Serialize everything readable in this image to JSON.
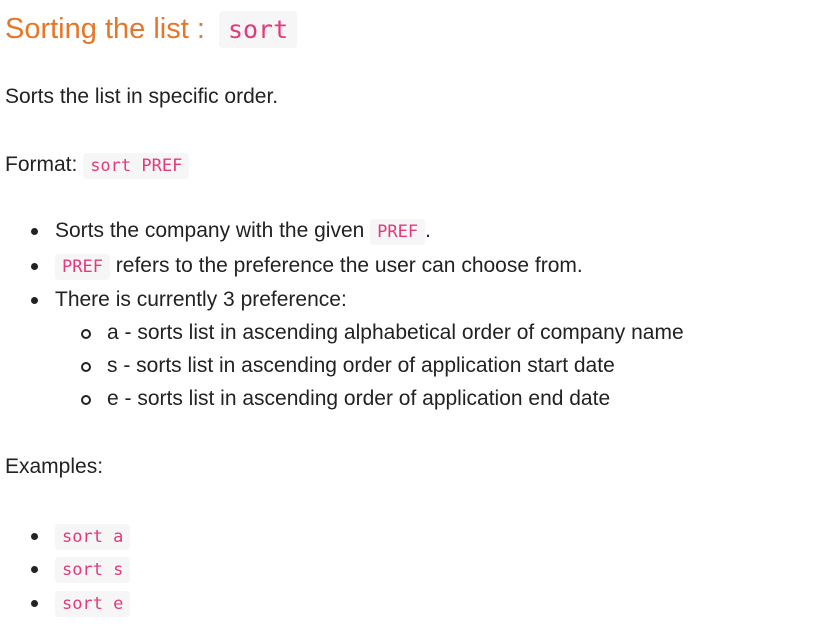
{
  "section": {
    "title": "Sorting the list : ",
    "command": "sort"
  },
  "description": "Sorts the list in specific order.",
  "format": {
    "label": "Format: ",
    "code": "sort PREF"
  },
  "details": {
    "item1_text": "Sorts the company with the given ",
    "item1_code": "PREF",
    "item1_end": ".",
    "item2_code": "PREF",
    "item2_text": " refers to the preference the user can choose from.",
    "item3_text": "There is currently 3 preference:",
    "preferences": [
      "a - sorts list in ascending alphabetical order of company name",
      "s - sorts list in ascending order of application start date",
      "e - sorts list in ascending order of application end date"
    ]
  },
  "examples": {
    "label": "Examples:",
    "items": [
      "sort a",
      "sort s",
      "sort e"
    ]
  }
}
